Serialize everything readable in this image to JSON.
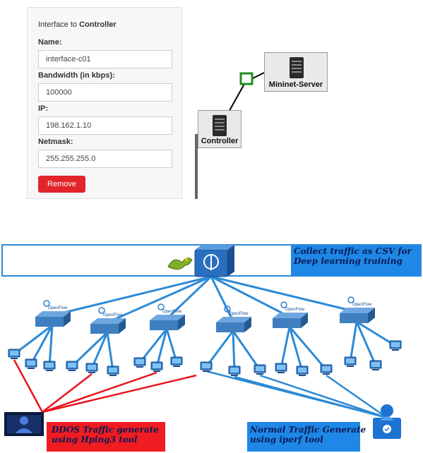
{
  "panel": {
    "title_prefix": "Interface to ",
    "title_target": "Controller",
    "fields": {
      "name": {
        "label": "Name:",
        "value": "interface-c01"
      },
      "bandwidth": {
        "label": "Bandwidth (in kbps):",
        "value": "100000"
      },
      "ip": {
        "label": "IP:",
        "value": "198.162.1.10"
      },
      "netmask": {
        "label": "Netmask:",
        "value": "255.255.255.0"
      }
    },
    "remove_label": "Remove"
  },
  "topology": {
    "controller_label": "Controller",
    "server_label": "Mininet-Server"
  },
  "diagram": {
    "collect_caption_line1": "Collect traffic as CSV for",
    "collect_caption_line2": "Deep learning training",
    "ddos_caption_line1": "DDOS Traffic generate",
    "ddos_caption_line2": "using Hping3 tool",
    "normal_caption_line1": "Normal Traffic Generate",
    "normal_caption_line2": "using iperf tool",
    "openflow_label": "OpenFlow",
    "colors": {
      "link": "#2c8ad6",
      "attack": "#e8141c",
      "switch": "#3f7fbf",
      "host": "#2f79c6",
      "collect_box": "#1f87e5",
      "ddos_box": "#ef1c22",
      "normal_box": "#1f87e5"
    }
  }
}
